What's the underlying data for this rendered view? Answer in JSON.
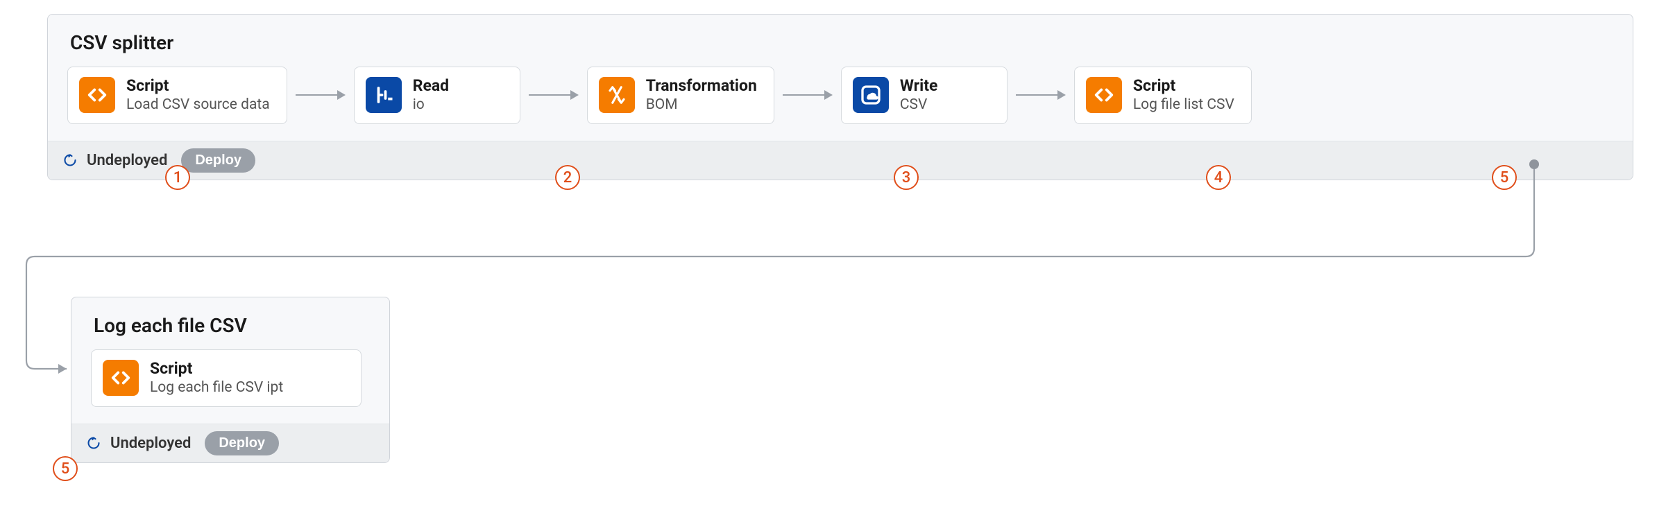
{
  "group1": {
    "title": "CSV splitter",
    "status": "Undeployed",
    "deploy_label": "Deploy",
    "nodes": [
      {
        "title": "Script",
        "sub": "Load CSV source data"
      },
      {
        "title": "Read",
        "sub": "io"
      },
      {
        "title": "Transformation",
        "sub": "BOM"
      },
      {
        "title": "Write",
        "sub": "CSV"
      },
      {
        "title": "Script",
        "sub": "Log file list CSV"
      }
    ]
  },
  "group2": {
    "title": "Log each file CSV",
    "status": "Undeployed",
    "deploy_label": "Deploy",
    "nodes": [
      {
        "title": "Script",
        "sub": "Log each file CSV ipt"
      }
    ]
  },
  "callouts": [
    "1",
    "2",
    "3",
    "4",
    "5",
    "5"
  ],
  "colors": {
    "orange": "#f57c00",
    "blue": "#0a49a6",
    "callout": "#e04e1a",
    "status_icon": "#0a49a6"
  }
}
